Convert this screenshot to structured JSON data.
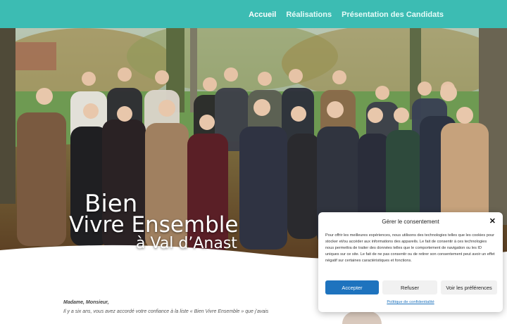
{
  "nav": {
    "items": [
      {
        "label": "Accueil",
        "active": true
      },
      {
        "label": "Réalisations",
        "active": false
      },
      {
        "label": "Présentation des Candidats",
        "active": false
      }
    ]
  },
  "hero": {
    "title_line1": "Bien",
    "title_line2": "Vivre Ensemble",
    "title_line3": "à Val d’Anast"
  },
  "letter": {
    "greeting": "Madame, Monsieur,",
    "body_start": "Il y a six ans, vous avez accordé votre confiance à la liste « Bien Vivre Ensemble » que j’avais"
  },
  "consent": {
    "title": "Gérer le consentement",
    "text": "Pour offrir les meilleures expériences, nous utilisons des technologies telles que les cookies pour stocker et/ou accéder aux informations des appareils. Le fait de consentir à ces technologies nous permettra de traiter des données telles que le comportement de navigation ou les ID uniques sur ce site. Le fait de ne pas consentir ou de retirer son consentement peut avoir un effet négatif sur certaines caractéristiques et fonctions.",
    "accept": "Accepter",
    "refuse": "Refuser",
    "preferences": "Voir les préférences",
    "privacy_link": "Politique de confidentialité"
  },
  "colors": {
    "header": "#3cbcb3",
    "accept_button": "#1e73be",
    "link": "#1e73be"
  }
}
